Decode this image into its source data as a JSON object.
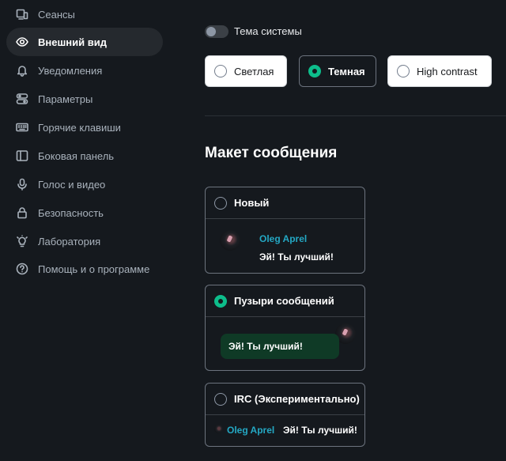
{
  "sidebar": {
    "items": [
      {
        "label": "Сеансы",
        "icon": "devices-icon"
      },
      {
        "label": "Внешний вид",
        "icon": "eye-icon",
        "active": true
      },
      {
        "label": "Уведомления",
        "icon": "bell-icon"
      },
      {
        "label": "Параметры",
        "icon": "settings-sliders-icon"
      },
      {
        "label": "Горячие клавиши",
        "icon": "keyboard-icon"
      },
      {
        "label": "Боковая панель",
        "icon": "sidebar-icon"
      },
      {
        "label": "Голос и видео",
        "icon": "microphone-icon"
      },
      {
        "label": "Безопасность",
        "icon": "lock-icon"
      },
      {
        "label": "Лаборатория",
        "icon": "lightbulb-icon"
      },
      {
        "label": "Помощь и о программе",
        "icon": "help-icon"
      }
    ]
  },
  "appearance": {
    "system_theme_label": "Тема системы",
    "system_theme_enabled": false,
    "themes": [
      {
        "label": "Светлая",
        "selected": false
      },
      {
        "label": "Темная",
        "selected": true
      },
      {
        "label": "High contrast",
        "selected": false
      }
    ]
  },
  "message_layout": {
    "title": "Макет сообщения",
    "options": [
      {
        "label": "Новый",
        "selected": false,
        "sender": "Oleg Aprel",
        "message": "Эй! Ты лучший!"
      },
      {
        "label": "Пузыри сообщений",
        "selected": true,
        "message": "Эй! Ты лучший!"
      },
      {
        "label": "IRC (Экспериментально)",
        "selected": false,
        "sender": "Oleg Aprel",
        "message": "Эй! Ты лучший!"
      }
    ]
  },
  "colors": {
    "background": "#15191e",
    "accent": "#0dbd8b",
    "sender_name": "#24a8c4",
    "bubble": "#0f3a26"
  }
}
